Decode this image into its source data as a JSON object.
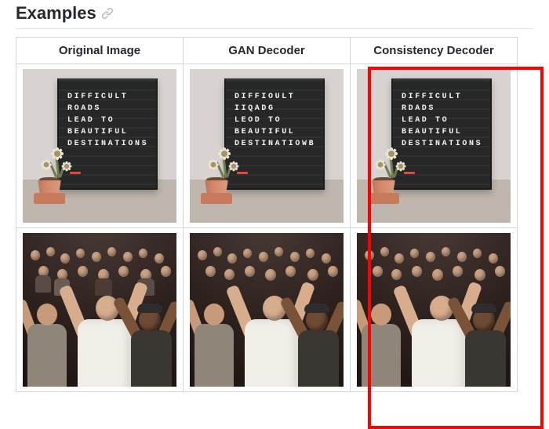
{
  "heading": "Examples",
  "columns": [
    "Original Image",
    "GAN Decoder",
    "Consistency Decoder"
  ],
  "highlighted_column_index": 2,
  "rows": [
    {
      "kind": "letterboard",
      "images": [
        {
          "board_text": "DIFFICULT\nROADS\nLEAD TO\nBEAUTIFUL\nDESTINATIONS"
        },
        {
          "board_text": "DIFFIOULT\nIIQADG\nLEOD TO\nBEAUTIFUL\nDESTINATIOWB"
        },
        {
          "board_text": "DIFFICULT\nRDADS\nLEAD TO\nBEAUTIFUL\nDESTINATIONS"
        }
      ]
    },
    {
      "kind": "crowd",
      "images": [
        {},
        {},
        {}
      ]
    }
  ]
}
